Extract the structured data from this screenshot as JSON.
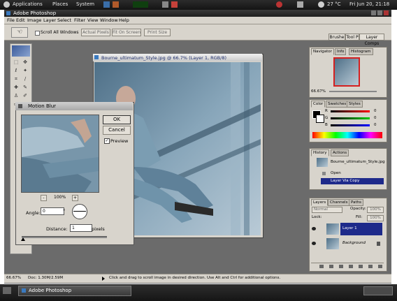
{
  "gnome_panel": {
    "menus": [
      "Applications",
      "Places",
      "System"
    ],
    "weather": "27 °C",
    "clock": "Fri Jun 20, 21:18"
  },
  "window": {
    "title": "Adobe Photoshop"
  },
  "menubar": {
    "items": [
      "File",
      "Edit",
      "Image",
      "Layer",
      "Select",
      "Filter",
      "View",
      "Window",
      "Help"
    ]
  },
  "options": {
    "scroll_all": "Scroll All Windows",
    "actual_pixels": "Actual Pixels",
    "fit_on_screen": "Fit On Screen",
    "print_size": "Print Size",
    "wells": [
      "Brushe",
      "Tool P",
      "Layer Comps"
    ]
  },
  "document": {
    "title": "Bourne_ultimatum_Style.jpg @ 66.7% (Layer 1, RGB/8)"
  },
  "dialog": {
    "title": "Motion Blur",
    "ok": "OK",
    "cancel": "Cancel",
    "preview_label": "Preview",
    "preview_checked": true,
    "zoom": "100%",
    "zoom_out": "-",
    "zoom_in": "+",
    "angle_label": "Angle:",
    "angle_value": "0",
    "angle_unit": "°",
    "distance_label": "Distance:",
    "distance_value": "1",
    "distance_unit": "pixels"
  },
  "navigator": {
    "tabs": [
      "Navigator",
      "Info",
      "Histogram"
    ],
    "zoom": "66.67%"
  },
  "color_panel": {
    "tabs": [
      "Color",
      "Swatches",
      "Styles"
    ],
    "channels": [
      {
        "label": "R",
        "value": "0"
      },
      {
        "label": "G",
        "value": "0"
      },
      {
        "label": "B",
        "value": "0"
      }
    ]
  },
  "history": {
    "tabs": [
      "History",
      "Actions"
    ],
    "snapshot": "Bourne_ultimatum_Style.jpg",
    "items": [
      "Open",
      "Layer Via Copy"
    ]
  },
  "layers": {
    "tabs": [
      "Layers",
      "Channels",
      "Paths"
    ],
    "blend_mode": "Normal",
    "opacity_label": "Opacity:",
    "opacity": "100%",
    "lock_label": "Lock:",
    "fill_label": "Fill:",
    "fill": "100%",
    "rows": [
      "Layer 1",
      "Background"
    ]
  },
  "status": {
    "zoom": "66.67%",
    "doc": "Doc: 1.30M/2.59M",
    "hint": "Click and drag to scroll image in desired direction.  Use Alt and Ctrl for additional options."
  },
  "taskbar": {
    "task": "Adobe Photoshop"
  },
  "colors": {
    "photo_tint": "#6d8ea4",
    "selection": "#1e2a8a"
  }
}
